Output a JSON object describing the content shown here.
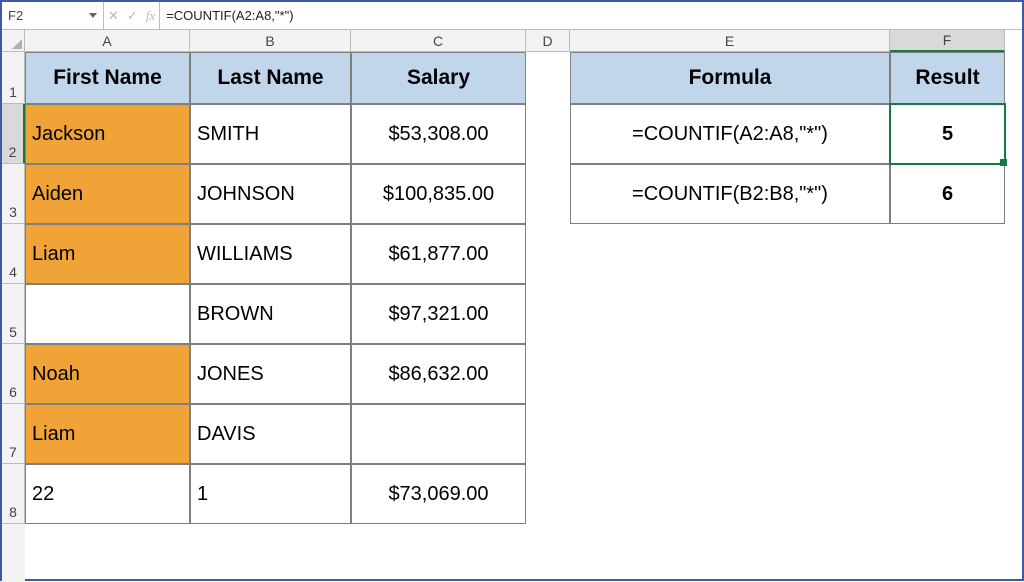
{
  "formula_bar": {
    "name_box": "F2",
    "cancel_glyph": "✕",
    "enter_glyph": "✓",
    "fx_glyph": "fx",
    "formula": "=COUNTIF(A2:A8,\"*\")"
  },
  "column_headers": [
    "A",
    "B",
    "C",
    "D",
    "E",
    "F"
  ],
  "row_headers": [
    "1",
    "2",
    "3",
    "4",
    "5",
    "6",
    "7",
    "8"
  ],
  "table1": {
    "h1": "First Name",
    "h2": "Last Name",
    "h3": "Salary",
    "rows": [
      {
        "fn": "Jackson",
        "ln": "SMITH",
        "sal": "$53,308.00",
        "fn_filled": true
      },
      {
        "fn": "Aiden",
        "ln": "JOHNSON",
        "sal": "$100,835.00",
        "fn_filled": true
      },
      {
        "fn": "Liam",
        "ln": "WILLIAMS",
        "sal": "$61,877.00",
        "fn_filled": true
      },
      {
        "fn": "",
        "ln": "BROWN",
        "sal": "$97,321.00",
        "fn_filled": false
      },
      {
        "fn": "Noah",
        "ln": "JONES",
        "sal": "$86,632.00",
        "fn_filled": true
      },
      {
        "fn": "Liam",
        "ln": "DAVIS",
        "sal": "",
        "fn_filled": true
      },
      {
        "fn": "22",
        "ln": "1",
        "sal": "$73,069.00",
        "fn_filled": false
      }
    ]
  },
  "table2": {
    "h1": "Formula",
    "h2": "Result",
    "rows": [
      {
        "formula": "=COUNTIF(A2:A8,\"*\")",
        "result": "5"
      },
      {
        "formula": "=COUNTIF(B2:B8,\"*\")",
        "result": "6"
      }
    ]
  },
  "active_cell": "F2",
  "chart_data": {
    "type": "table",
    "left_table": {
      "columns": [
        "First Name",
        "Last Name",
        "Salary"
      ],
      "rows": [
        [
          "Jackson",
          "SMITH",
          "$53,308.00"
        ],
        [
          "Aiden",
          "JOHNSON",
          "$100,835.00"
        ],
        [
          "Liam",
          "WILLIAMS",
          "$61,877.00"
        ],
        [
          "",
          "BROWN",
          "$97,321.00"
        ],
        [
          "Noah",
          "JONES",
          "$86,632.00"
        ],
        [
          "Liam",
          "DAVIS",
          ""
        ],
        [
          "22",
          "1",
          "$73,069.00"
        ]
      ]
    },
    "right_table": {
      "columns": [
        "Formula",
        "Result"
      ],
      "rows": [
        [
          "=COUNTIF(A2:A8,\"*\")",
          "5"
        ],
        [
          "=COUNTIF(B2:B8,\"*\")",
          "6"
        ]
      ]
    }
  }
}
